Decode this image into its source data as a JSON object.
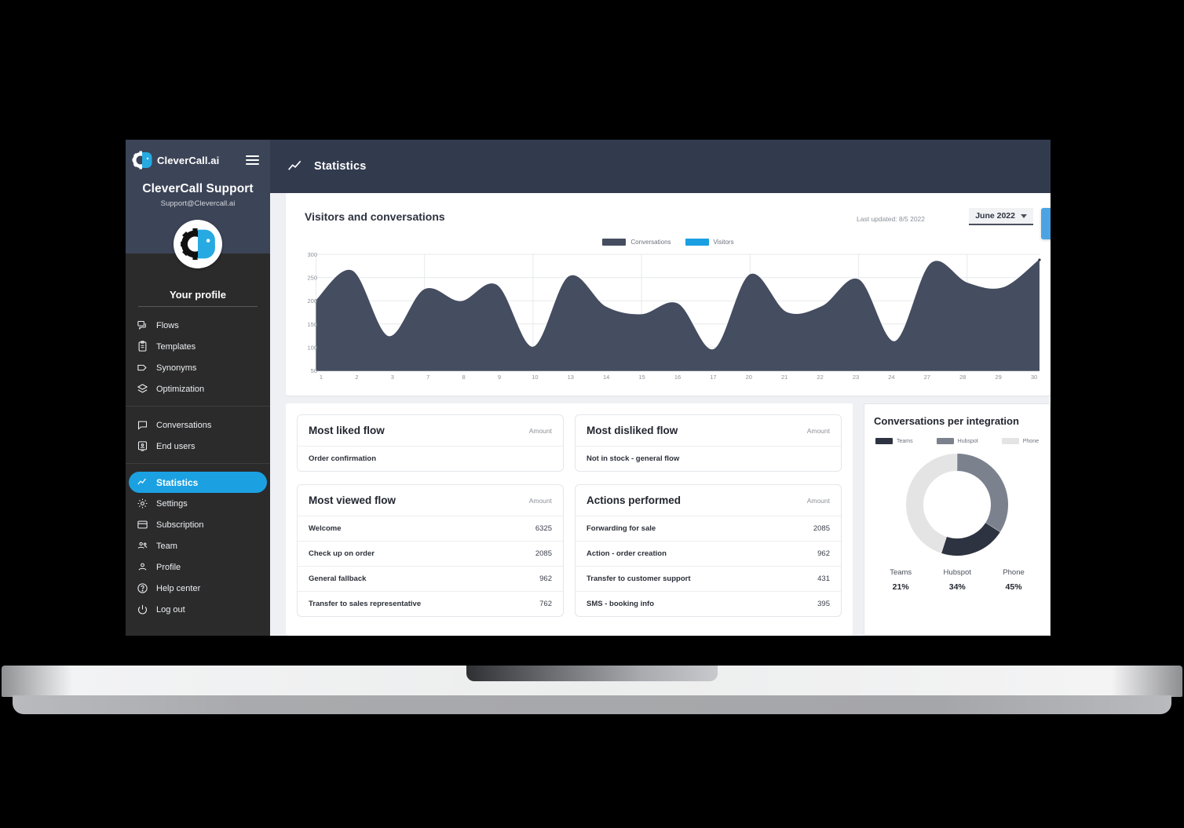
{
  "sidebar": {
    "brand": "CleverCall.ai",
    "account_name": "CleverCall Support",
    "account_email": "Support@Clevercall.ai",
    "profile_label": "Your profile",
    "group1": [
      {
        "label": "Flows",
        "icon": "flows-icon"
      },
      {
        "label": "Templates",
        "icon": "templates-icon"
      },
      {
        "label": "Synonyms",
        "icon": "tag-icon"
      },
      {
        "label": "Optimization",
        "icon": "layers-icon"
      }
    ],
    "group2": [
      {
        "label": "Conversations",
        "icon": "chat-icon"
      },
      {
        "label": "End users",
        "icon": "end-users-icon"
      }
    ],
    "group3": [
      {
        "label": "Statistics",
        "icon": "chart-line-icon",
        "active": true
      },
      {
        "label": "Settings",
        "icon": "gear-icon"
      },
      {
        "label": "Subscription",
        "icon": "card-icon"
      },
      {
        "label": "Team",
        "icon": "team-icon"
      },
      {
        "label": "Profile",
        "icon": "person-icon"
      },
      {
        "label": "Help center",
        "icon": "question-icon"
      },
      {
        "label": "Log out",
        "icon": "power-icon"
      }
    ]
  },
  "topbar": {
    "title": "Statistics",
    "icon": "chart-line-icon"
  },
  "panel": {
    "title": "Visitors and conversations",
    "last_updated": "Last updated: 8/5 2022",
    "period": "June 2022"
  },
  "colors": {
    "accent": "#1ba1e2",
    "conversations": "#454d60",
    "visitors": "#199fe2",
    "teams": "#2d3340",
    "hubspot": "#7c818e",
    "phone": "#e4e4e4",
    "sidebar_bg": "#2b2b2b",
    "sidebar_head": "#3c4457",
    "topbar_bg": "#323b4e"
  },
  "chart_data": {
    "type": "area",
    "title": "Visitors and conversations",
    "xlabel": "",
    "ylabel": "",
    "ylim": [
      50,
      300
    ],
    "yticks": [
      50,
      100,
      150,
      200,
      250,
      300
    ],
    "grid": true,
    "legend_position": "top-center",
    "categories": [
      1,
      2,
      3,
      7,
      8,
      9,
      10,
      13,
      14,
      15,
      16,
      17,
      20,
      21,
      22,
      23,
      24,
      27,
      28,
      29,
      30
    ],
    "series": [
      {
        "name": "Conversations",
        "color": "#454d60",
        "values": [
          200,
          264,
          123,
          224,
          198,
          233,
          100,
          252,
          187,
          170,
          193,
          95,
          256,
          175,
          188,
          245,
          112,
          280,
          238,
          228,
          288
        ]
      },
      {
        "name": "Visitors",
        "color": "#199fe2",
        "values": []
      }
    ]
  },
  "cards": {
    "most_liked": {
      "title": "Most liked flow",
      "amount_header": "Amount",
      "rows": [
        {
          "name": "Order confirmation",
          "value": ""
        }
      ]
    },
    "most_disliked": {
      "title": "Most disliked flow",
      "amount_header": "Amount",
      "rows": [
        {
          "name": "Not in stock - general flow",
          "value": ""
        }
      ]
    },
    "most_viewed": {
      "title": "Most viewed flow",
      "amount_header": "Amount",
      "rows": [
        {
          "name": "Welcome",
          "value": "6325"
        },
        {
          "name": "Check up on order",
          "value": "2085"
        },
        {
          "name": "General fallback",
          "value": "962"
        },
        {
          "name": "Transfer to sales representative",
          "value": "762"
        }
      ]
    },
    "actions_performed": {
      "title": "Actions performed",
      "amount_header": "Amount",
      "rows": [
        {
          "name": "Forwarding for sale",
          "value": "2085"
        },
        {
          "name": "Action - order creation",
          "value": "962"
        },
        {
          "name": "Transfer to customer support",
          "value": "431"
        },
        {
          "name": "SMS - booking info",
          "value": "395"
        }
      ]
    }
  },
  "integration_chart": {
    "type": "pie",
    "title": "Conversations per integration",
    "categories": [
      "Teams",
      "Hubspot",
      "Phone"
    ],
    "values": [
      21,
      34,
      45
    ],
    "labels": [
      "21%",
      "34%",
      "45%"
    ],
    "colors": [
      "#2d3340",
      "#7c818e",
      "#e4e4e4"
    ]
  }
}
